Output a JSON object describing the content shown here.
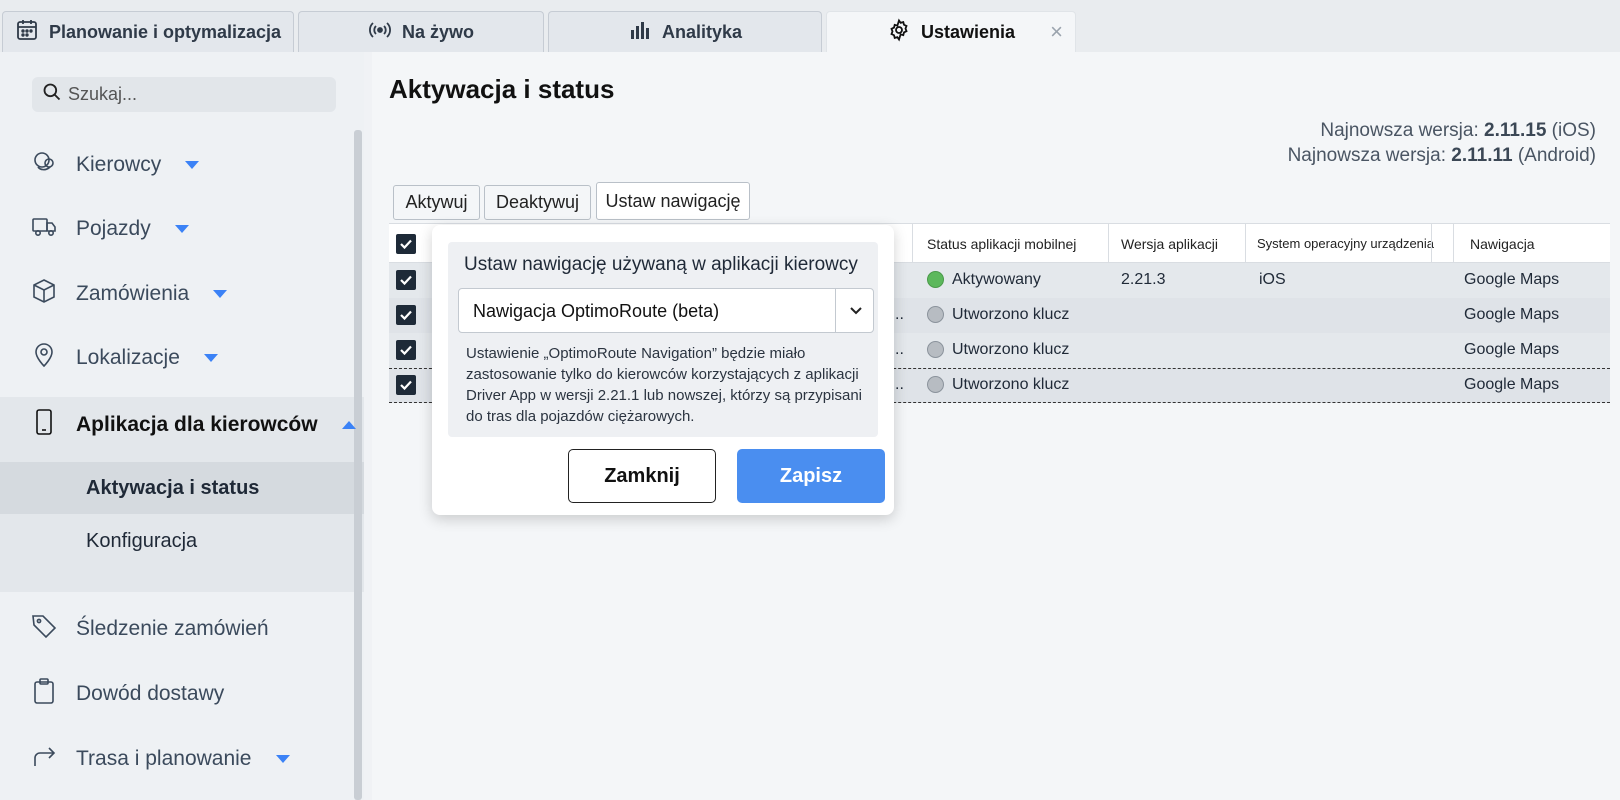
{
  "tabs": [
    {
      "label": "Planowanie i optymalizacja",
      "icon": "calendar-icon"
    },
    {
      "label": "Na żywo",
      "icon": "broadcast-icon"
    },
    {
      "label": "Analityka",
      "icon": "bar-chart-icon"
    },
    {
      "label": "Ustawienia",
      "icon": "gear-icon",
      "active": true
    }
  ],
  "sidebar": {
    "search_placeholder": "Szukaj...",
    "items": [
      {
        "label": "Kierowcy",
        "icon": "users-icon"
      },
      {
        "label": "Pojazdy",
        "icon": "truck-icon"
      },
      {
        "label": "Zamówienia",
        "icon": "package-icon"
      },
      {
        "label": "Lokalizacje",
        "icon": "location-pin-icon"
      },
      {
        "label": "Aplikacja dla kierowców",
        "icon": "phone-icon"
      },
      {
        "label": "Śledzenie zamówień",
        "icon": "tag-icon"
      },
      {
        "label": "Dowód dostawy",
        "icon": "clipboard-icon"
      },
      {
        "label": "Trasa i planowanie",
        "icon": "route-arrow-icon"
      }
    ],
    "subitems": [
      {
        "label": "Aktywacja i status",
        "active": true
      },
      {
        "label": "Konfiguracja"
      }
    ]
  },
  "main": {
    "title": "Aktywacja i status",
    "version_label": "Najnowsza wersja:",
    "ios_version": "2.11.15",
    "ios_suffix": "(iOS)",
    "android_version": "2.11.11",
    "android_suffix": "(Android)",
    "buttons": {
      "activate": "Aktywuj",
      "deactivate": "Deaktywuj",
      "set_nav": "Ustaw nawigację"
    }
  },
  "table": {
    "headers": {
      "status": "Status aplikacji mobilnej",
      "version": "Wersja aplikacji",
      "os": "System operacyjny urządzenia",
      "nav": "Nawigacja"
    },
    "rows": [
      {
        "truncated": "..",
        "status": "Aktywowany",
        "status_color": "#5cb85c",
        "version": "2.21.3",
        "os": "iOS",
        "nav": "Google Maps"
      },
      {
        "truncated": "..",
        "status": "Utworzono klucz",
        "status_color": "#b7bcc2",
        "version": "",
        "os": "",
        "nav": "Google Maps"
      },
      {
        "truncated": "..",
        "status": "Utworzono klucz",
        "status_color": "#b7bcc2",
        "version": "",
        "os": "",
        "nav": "Google Maps"
      },
      {
        "truncated": "..",
        "status": "Utworzono klucz",
        "status_color": "#b7bcc2",
        "version": "",
        "os": "",
        "nav": "Google Maps"
      }
    ]
  },
  "modal": {
    "title": "Ustaw nawigację używaną w aplikacji kierowcy",
    "select_value": "Nawigacja OptimoRoute (beta)",
    "help": "Ustawienie „OptimoRoute Navigation” będzie miało zastosowanie tylko do kierowców korzystających z aplikacji Driver App w wersji 2.21.1 lub nowszej, którzy są przypisani do tras dla pojazdów ciężarowych.",
    "close_label": "Zamknij",
    "save_label": "Zapisz"
  },
  "colors": {
    "accent": "#4a8ef0",
    "caret": "#3b82f6",
    "active_status": "#5cb85c"
  }
}
